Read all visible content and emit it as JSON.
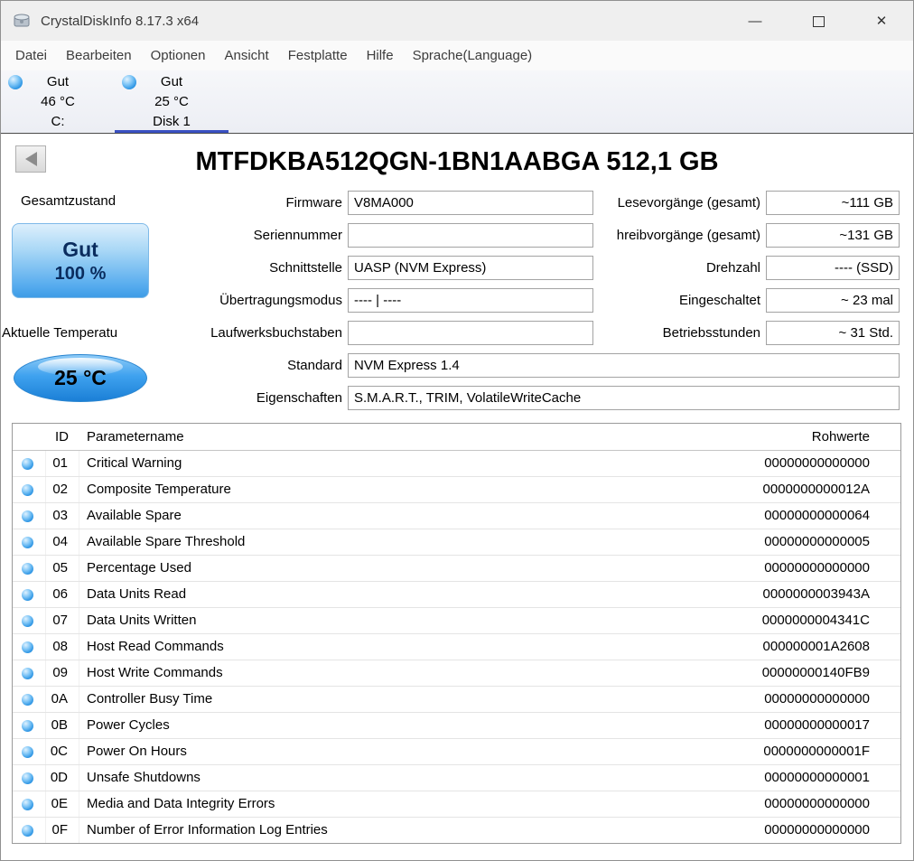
{
  "window": {
    "title": "CrystalDiskInfo 8.17.3 x64",
    "minimize_glyph": "—",
    "close_glyph": "✕"
  },
  "menu": {
    "items": [
      "Datei",
      "Bearbeiten",
      "Optionen",
      "Ansicht",
      "Festplatte",
      "Hilfe",
      "Sprache(Language)"
    ]
  },
  "disk_tabs": [
    {
      "status": "Gut",
      "temperature": "46 °C",
      "name": "C:",
      "selected": false
    },
    {
      "status": "Gut",
      "temperature": "25 °C",
      "name": "Disk 1",
      "selected": true
    }
  ],
  "drive": {
    "model_title": "MTFDKBA512QGN-1BN1AABGA 512,1 GB",
    "health": {
      "label": "Gesamtzustand",
      "status": "Gut",
      "percent": "100 %"
    },
    "temperature": {
      "label": "Aktuelle Temperatu",
      "value": "25 °C"
    },
    "info_left": [
      {
        "label": "Firmware",
        "value": "V8MA000"
      },
      {
        "label": "Seriennummer",
        "value": ""
      },
      {
        "label": "Schnittstelle",
        "value": "UASP (NVM Express)"
      },
      {
        "label": "Übertragungsmodus",
        "value": "---- | ----"
      },
      {
        "label": "Laufwerksbuchstaben",
        "value": ""
      }
    ],
    "info_right": [
      {
        "label": "Lesevorgänge (gesamt)",
        "value": "~111 GB"
      },
      {
        "label": "hreibvorgänge (gesamt)",
        "value": "~131 GB"
      },
      {
        "label": "Drehzahl",
        "value": "---- (SSD)"
      },
      {
        "label": "Eingeschaltet",
        "value": "~ 23 mal"
      },
      {
        "label": "Betriebsstunden",
        "value": "~ 31 Std."
      }
    ],
    "info_wide": [
      {
        "label": "Standard",
        "value": "NVM Express 1.4"
      },
      {
        "label": "Eigenschaften",
        "value": "S.M.A.R.T., TRIM, VolatileWriteCache"
      }
    ]
  },
  "smart_table": {
    "header": {
      "id": "ID",
      "name": "Parametername",
      "raw": "Rohwerte"
    },
    "rows": [
      {
        "id": "01",
        "name": "Critical Warning",
        "raw": "00000000000000"
      },
      {
        "id": "02",
        "name": "Composite Temperature",
        "raw": "0000000000012A"
      },
      {
        "id": "03",
        "name": "Available Spare",
        "raw": "00000000000064"
      },
      {
        "id": "04",
        "name": "Available Spare Threshold",
        "raw": "00000000000005"
      },
      {
        "id": "05",
        "name": "Percentage Used",
        "raw": "00000000000000"
      },
      {
        "id": "06",
        "name": "Data Units Read",
        "raw": "0000000003943A"
      },
      {
        "id": "07",
        "name": "Data Units Written",
        "raw": "0000000004341C"
      },
      {
        "id": "08",
        "name": "Host Read Commands",
        "raw": "000000001A2608"
      },
      {
        "id": "09",
        "name": "Host Write Commands",
        "raw": "00000000140FB9"
      },
      {
        "id": "0A",
        "name": "Controller Busy Time",
        "raw": "00000000000000"
      },
      {
        "id": "0B",
        "name": "Power Cycles",
        "raw": "00000000000017"
      },
      {
        "id": "0C",
        "name": "Power On Hours",
        "raw": "0000000000001F"
      },
      {
        "id": "0D",
        "name": "Unsafe Shutdowns",
        "raw": "00000000000001"
      },
      {
        "id": "0E",
        "name": "Media and Data Integrity Errors",
        "raw": "00000000000000"
      },
      {
        "id": "0F",
        "name": "Number of Error Information Log Entries",
        "raw": "00000000000000"
      }
    ]
  }
}
